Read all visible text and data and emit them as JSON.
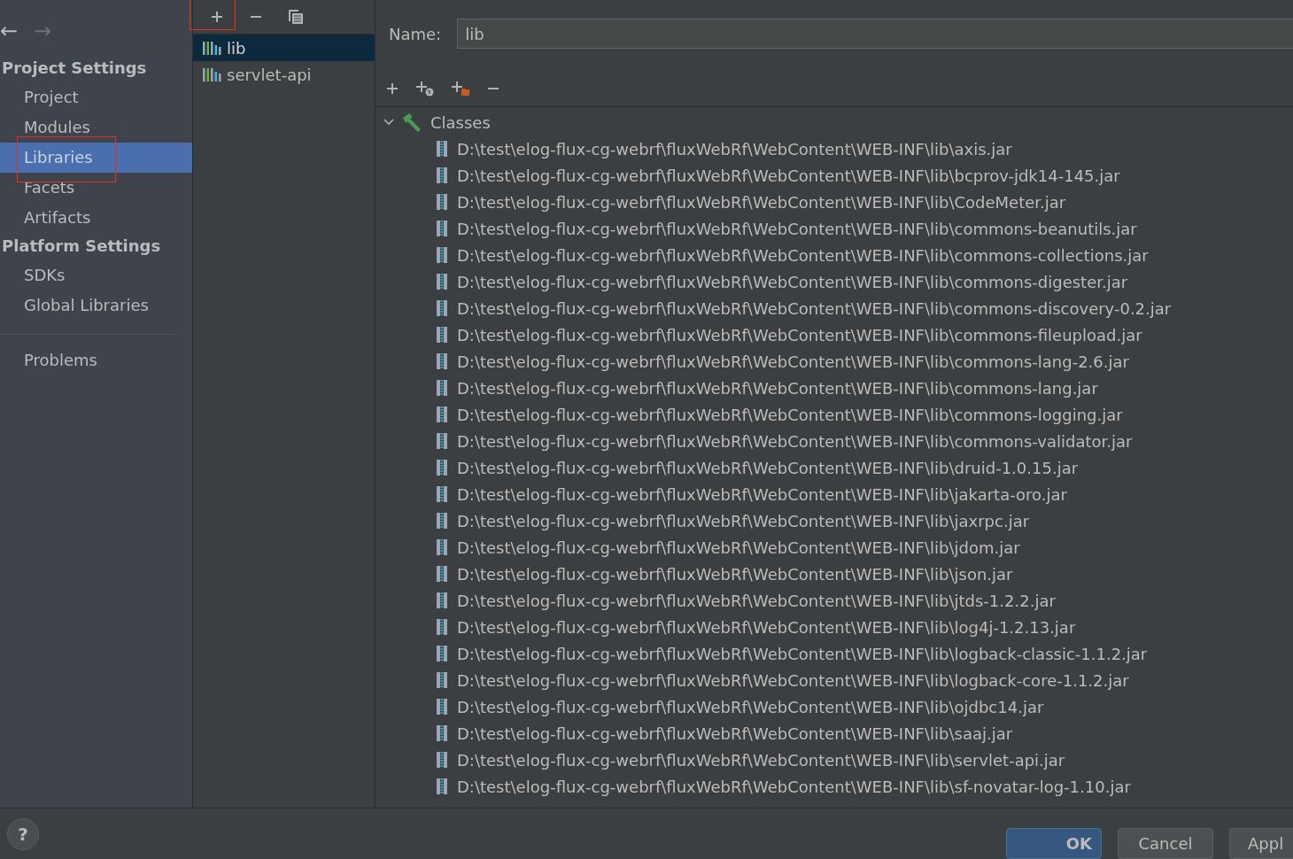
{
  "nav": {
    "back": "←",
    "forward": "→"
  },
  "sidebar": {
    "sections": [
      {
        "title": "Project Settings",
        "items": [
          {
            "label": "Project",
            "selected": false
          },
          {
            "label": "Modules",
            "selected": false
          },
          {
            "label": "Libraries",
            "selected": true
          },
          {
            "label": "Facets",
            "selected": false
          },
          {
            "label": "Artifacts",
            "selected": false
          }
        ]
      },
      {
        "title": "Platform Settings",
        "items": [
          {
            "label": "SDKs",
            "selected": false
          },
          {
            "label": "Global Libraries",
            "selected": false
          }
        ]
      }
    ],
    "footer_items": [
      {
        "label": "Problems",
        "selected": false
      }
    ]
  },
  "libraries": [
    {
      "name": "lib",
      "selected": true
    },
    {
      "name": "servlet-api",
      "selected": false
    }
  ],
  "name_field": {
    "label": "Name:",
    "value": "lib"
  },
  "tree": {
    "label": "Classes",
    "expanded": true,
    "children": [
      {
        "label": "D:\\test\\elog-flux-cg-webrf\\fluxWebRf\\WebContent\\WEB-INF\\lib\\axis.jar"
      },
      {
        "label": "D:\\test\\elog-flux-cg-webrf\\fluxWebRf\\WebContent\\WEB-INF\\lib\\bcprov-jdk14-145.jar"
      },
      {
        "label": "D:\\test\\elog-flux-cg-webrf\\fluxWebRf\\WebContent\\WEB-INF\\lib\\CodeMeter.jar"
      },
      {
        "label": "D:\\test\\elog-flux-cg-webrf\\fluxWebRf\\WebContent\\WEB-INF\\lib\\commons-beanutils.jar"
      },
      {
        "label": "D:\\test\\elog-flux-cg-webrf\\fluxWebRf\\WebContent\\WEB-INF\\lib\\commons-collections.jar"
      },
      {
        "label": "D:\\test\\elog-flux-cg-webrf\\fluxWebRf\\WebContent\\WEB-INF\\lib\\commons-digester.jar"
      },
      {
        "label": "D:\\test\\elog-flux-cg-webrf\\fluxWebRf\\WebContent\\WEB-INF\\lib\\commons-discovery-0.2.jar"
      },
      {
        "label": "D:\\test\\elog-flux-cg-webrf\\fluxWebRf\\WebContent\\WEB-INF\\lib\\commons-fileupload.jar"
      },
      {
        "label": "D:\\test\\elog-flux-cg-webrf\\fluxWebRf\\WebContent\\WEB-INF\\lib\\commons-lang-2.6.jar"
      },
      {
        "label": "D:\\test\\elog-flux-cg-webrf\\fluxWebRf\\WebContent\\WEB-INF\\lib\\commons-lang.jar"
      },
      {
        "label": "D:\\test\\elog-flux-cg-webrf\\fluxWebRf\\WebContent\\WEB-INF\\lib\\commons-logging.jar"
      },
      {
        "label": "D:\\test\\elog-flux-cg-webrf\\fluxWebRf\\WebContent\\WEB-INF\\lib\\commons-validator.jar"
      },
      {
        "label": "D:\\test\\elog-flux-cg-webrf\\fluxWebRf\\WebContent\\WEB-INF\\lib\\druid-1.0.15.jar"
      },
      {
        "label": "D:\\test\\elog-flux-cg-webrf\\fluxWebRf\\WebContent\\WEB-INF\\lib\\jakarta-oro.jar"
      },
      {
        "label": "D:\\test\\elog-flux-cg-webrf\\fluxWebRf\\WebContent\\WEB-INF\\lib\\jaxrpc.jar"
      },
      {
        "label": "D:\\test\\elog-flux-cg-webrf\\fluxWebRf\\WebContent\\WEB-INF\\lib\\jdom.jar"
      },
      {
        "label": "D:\\test\\elog-flux-cg-webrf\\fluxWebRf\\WebContent\\WEB-INF\\lib\\json.jar"
      },
      {
        "label": "D:\\test\\elog-flux-cg-webrf\\fluxWebRf\\WebContent\\WEB-INF\\lib\\jtds-1.2.2.jar"
      },
      {
        "label": "D:\\test\\elog-flux-cg-webrf\\fluxWebRf\\WebContent\\WEB-INF\\lib\\log4j-1.2.13.jar"
      },
      {
        "label": "D:\\test\\elog-flux-cg-webrf\\fluxWebRf\\WebContent\\WEB-INF\\lib\\logback-classic-1.1.2.jar"
      },
      {
        "label": "D:\\test\\elog-flux-cg-webrf\\fluxWebRf\\WebContent\\WEB-INF\\lib\\logback-core-1.1.2.jar"
      },
      {
        "label": "D:\\test\\elog-flux-cg-webrf\\fluxWebRf\\WebContent\\WEB-INF\\lib\\ojdbc14.jar"
      },
      {
        "label": "D:\\test\\elog-flux-cg-webrf\\fluxWebRf\\WebContent\\WEB-INF\\lib\\saaj.jar"
      },
      {
        "label": "D:\\test\\elog-flux-cg-webrf\\fluxWebRf\\WebContent\\WEB-INF\\lib\\servlet-api.jar"
      },
      {
        "label": "D:\\test\\elog-flux-cg-webrf\\fluxWebRf\\WebContent\\WEB-INF\\lib\\sf-novatar-log-1.10.jar"
      }
    ]
  },
  "help": "?",
  "buttons": [
    {
      "label": "OK",
      "kind": "default"
    },
    {
      "label": "Cancel",
      "kind": "normal"
    },
    {
      "label": "Appl",
      "kind": "normal"
    }
  ]
}
